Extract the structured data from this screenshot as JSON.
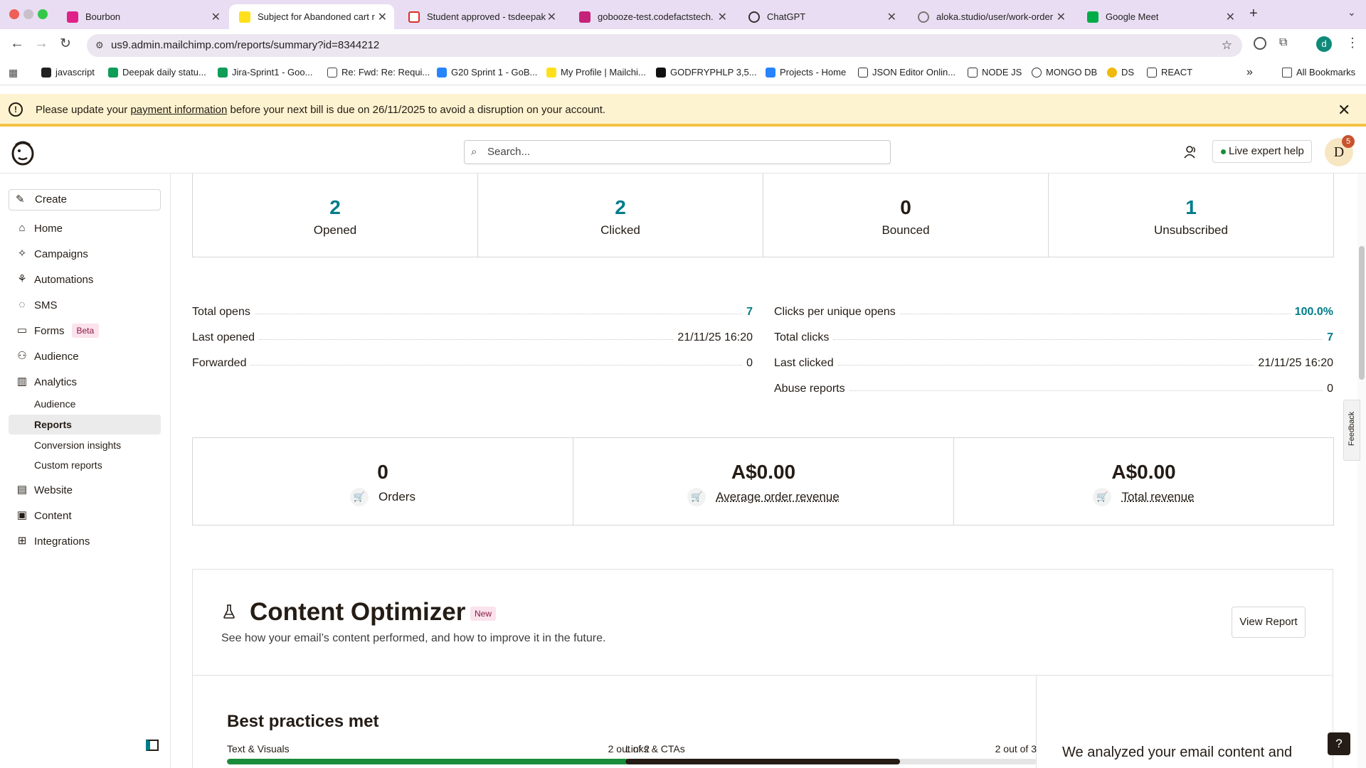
{
  "browser": {
    "tabs": [
      {
        "title": "Bourbon",
        "active": false,
        "icon": "mailchimp-favicon"
      },
      {
        "title": "Subject for Abandoned cart r",
        "active": true,
        "icon": "mailchimp-favicon"
      },
      {
        "title": "Student approved - tsdeepak",
        "active": false,
        "icon": "gmail-favicon"
      },
      {
        "title": "gobooze-test.codefactstech.",
        "active": false,
        "icon": "gobooze-favicon"
      },
      {
        "title": "ChatGPT",
        "active": false,
        "icon": "chatgpt-favicon"
      },
      {
        "title": "aloka.studio/user/work-order",
        "active": false,
        "icon": "globe-favicon"
      },
      {
        "title": "Google Meet",
        "active": false,
        "icon": "meet-favicon"
      }
    ],
    "url": "us9.admin.mailchimp.com/reports/summary?id=8344212",
    "profile_initial": "d",
    "bookmarks": [
      "javascript",
      "Deepak daily statu...",
      "Jira-Sprint1 - Goo...",
      "Re: Fwd: Re: Requi...",
      "G20 Sprint 1 - GoB...",
      "My Profile | Mailchi...",
      "GODFRYPHLP 3,5...",
      "Projects - Home",
      "JSON Editor Onlin...",
      "NODE JS",
      "MONGO DB",
      "DS",
      "REACT"
    ],
    "all_bookmarks": "All Bookmarks",
    "overflow": "»"
  },
  "banner": {
    "before": "Please update your ",
    "link": "payment information",
    "after": " before your next bill is due on 26/11/2025 to avoid a disruption on your account."
  },
  "header": {
    "search_placeholder": "Search...",
    "live_help": "Live expert help",
    "avatar_initial": "D",
    "notification_count": "5"
  },
  "sidebar": {
    "create": "Create",
    "items": [
      "Home",
      "Campaigns",
      "Automations",
      "SMS",
      "Forms",
      "Audience",
      "Analytics"
    ],
    "forms_badge": "Beta",
    "analytics_sub": [
      "Audience",
      "Reports",
      "Conversion insights",
      "Custom reports"
    ],
    "items2": [
      "Website",
      "Content",
      "Integrations"
    ]
  },
  "stats": [
    {
      "value": "2",
      "label": "Opened"
    },
    {
      "value": "2",
      "label": "Clicked"
    },
    {
      "value": "0",
      "label": "Bounced"
    },
    {
      "value": "1",
      "label": "Unsubscribed"
    }
  ],
  "details_left": [
    {
      "label": "Total opens",
      "value": "7"
    },
    {
      "label": "Last opened",
      "value": "21/11/25 16:20"
    },
    {
      "label": "Forwarded",
      "value": "0"
    }
  ],
  "details_right": [
    {
      "label": "Clicks per unique opens",
      "value": "100.0%"
    },
    {
      "label": "Total clicks",
      "value": "7"
    },
    {
      "label": "Last clicked",
      "value": "21/11/25 16:20"
    },
    {
      "label": "Abuse reports",
      "value": "0"
    }
  ],
  "ecommerce": [
    {
      "value": "0",
      "label": "Orders"
    },
    {
      "value": "A$0.00",
      "label": "Average order revenue"
    },
    {
      "value": "A$0.00",
      "label": "Total revenue"
    }
  ],
  "optimizer": {
    "title": "Content Optimizer",
    "badge": "New",
    "subtitle": "See how your email’s content performed, and how to improve it in the future.",
    "view_report": "View Report",
    "best_title": "Best practices met",
    "bars": [
      {
        "label": "Text & Visuals",
        "score": "2 out of 2",
        "fraction": 1.0,
        "color": "#1a8d3a"
      },
      {
        "label": "Links & CTAs",
        "score": "2 out of 3",
        "fraction": 0.667,
        "color": "#241c15"
      }
    ],
    "analysis": "We analyzed your email content and"
  },
  "feedback_tab": "Feedback",
  "help": "?"
}
